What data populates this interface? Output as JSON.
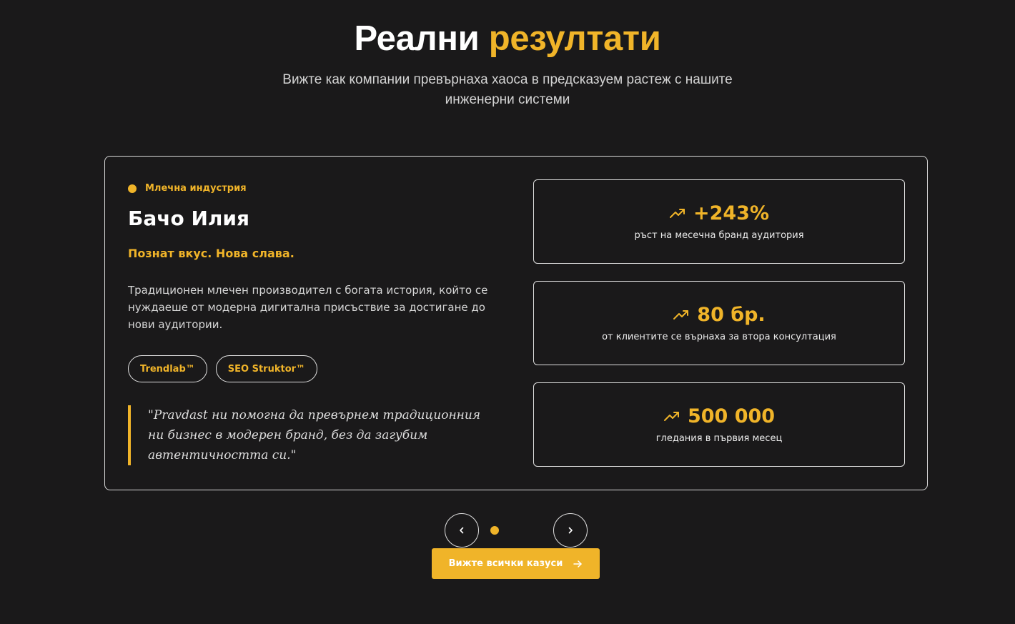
{
  "header": {
    "title_main": "Реални",
    "title_accent": "резултати",
    "subtitle": "Вижте как компании превърнаха хаоса в предсказуем растеж с нашите инженерни системи"
  },
  "case": {
    "industry": "Млечна индустрия",
    "client": "Бачо Илия",
    "tagline": "Познат вкус. Нова слава.",
    "description": "Традиционен млечен производител с богата история, който се нуждаеше от модерна дигитална присъствие за достигане до нови аудитории.",
    "tags": [
      "Trendlab™",
      "SEO Struktor™"
    ],
    "quote": "\"Pravdast ни помогна да превърнем традиционния ни бизнес в модерен бранд, без да загубим автентичността си.\"",
    "stats": [
      {
        "value": "+243%",
        "label": "ръст на месечна бранд аудитория",
        "icon": "trending-up-icon"
      },
      {
        "value": "80 бр.",
        "label": "от клиентите се върнаха за втора консултация",
        "icon": "trending-up-icon"
      },
      {
        "value": "500 000",
        "label": "гледания в първия месец",
        "icon": "trending-up-icon"
      }
    ]
  },
  "carousel": {
    "prev_icon": "chevron-left-icon",
    "next_icon": "chevron-right-icon",
    "active_index": 0,
    "count": 1
  },
  "cta": {
    "label": "Вижте всички казуси",
    "icon": "arrow-right-icon"
  },
  "colors": {
    "background": "#1a191a",
    "accent": "#f0b429",
    "border": "#e0e0e0"
  }
}
